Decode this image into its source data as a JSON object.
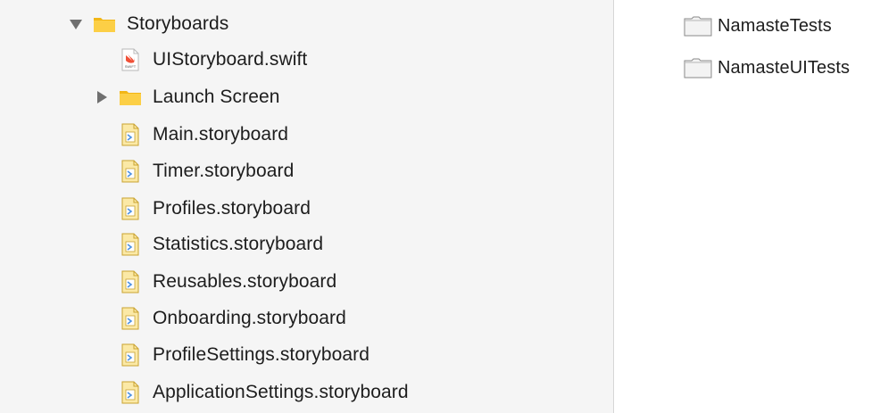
{
  "navigator": {
    "items": [
      {
        "label": "Storyboards",
        "icon": "folder-icon",
        "expanded": true
      },
      {
        "label": "UIStoryboard.swift",
        "icon": "swift-file-icon"
      },
      {
        "label": "Launch Screen",
        "icon": "folder-icon",
        "expanded": false
      },
      {
        "label": "Main.storyboard",
        "icon": "storyboard-file-icon"
      },
      {
        "label": "Timer.storyboard",
        "icon": "storyboard-file-icon"
      },
      {
        "label": "Profiles.storyboard",
        "icon": "storyboard-file-icon"
      },
      {
        "label": "Statistics.storyboard",
        "icon": "storyboard-file-icon"
      },
      {
        "label": "Reusables.storyboard",
        "icon": "storyboard-file-icon"
      },
      {
        "label": "Onboarding.storyboard",
        "icon": "storyboard-file-icon"
      },
      {
        "label": "ProfileSettings.storyboard",
        "icon": "storyboard-file-icon"
      },
      {
        "label": "ApplicationSettings.storyboard",
        "icon": "storyboard-file-icon"
      }
    ]
  },
  "targets": {
    "items": [
      {
        "label": "NamasteTests",
        "icon": "test-bundle-icon"
      },
      {
        "label": "NamasteUITests",
        "icon": "test-bundle-icon"
      }
    ]
  },
  "colors": {
    "folder": "#f7c531",
    "pane_background": "#f5f5f5",
    "swift": "#f05138"
  }
}
